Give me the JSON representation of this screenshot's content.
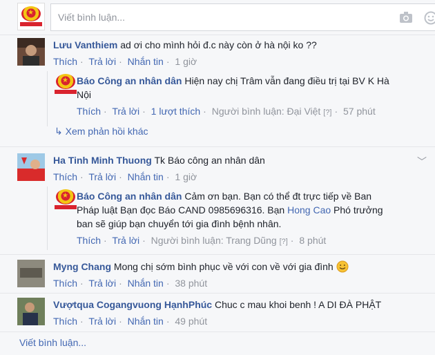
{
  "composer": {
    "placeholder": "Viết bình luận..."
  },
  "comments": [
    {
      "name": "Lưu Vanthiem",
      "text": "ad ơi cho mình hỏi đ.c này còn ở hà nội ko ??",
      "actions": {
        "like": "Thích",
        "reply": "Trả lời",
        "message": "Nhắn tin",
        "time": "1 giờ"
      },
      "reply": {
        "name": "Báo Công an nhân dân",
        "text_line1": "Hiện nay chị Trâm vẫn đang điều trị tại BV K Hà",
        "text_line2": "Nội",
        "actions": {
          "like": "Thích",
          "reply": "Trả lời",
          "likes": "1 lượt thích",
          "answered_by": "Người bình luận: Đại Việt",
          "help": "[?]",
          "time": "57 phút"
        }
      },
      "more_replies": "Xem phản hồi khác"
    },
    {
      "name": "Ha Tinh Minh Thuong",
      "text": "Tk Báo công an nhân dân",
      "actions": {
        "like": "Thích",
        "reply": "Trả lời",
        "message": "Nhắn tin",
        "time": "1 giờ"
      },
      "reply": {
        "name": "Báo Công an nhân dân",
        "text_line1a": "Cảm ơn bạn. Bạn có thể đt trực tiếp về Ban",
        "text_line2": "Pháp luật Bạn đọc Báo CAND 0985696316. Bạn",
        "mention": "Hong Cao",
        "text_line2b": "Phó trưởng",
        "text_line3": "ban sẽ giúp bạn chuyển tới gia đình bệnh nhân.",
        "actions": {
          "like": "Thích",
          "reply": "Trả lời",
          "answered_by": "Người bình luận: Trang Dũng",
          "help": "[?]",
          "time": "8 phút"
        }
      }
    },
    {
      "name": "Myng Chang",
      "text": "Mong chị sớm bình phục về với con về với gia đình",
      "actions": {
        "like": "Thích",
        "reply": "Trả lời",
        "message": "Nhắn tin",
        "time": "38 phút"
      }
    },
    {
      "name": "Vượtqua Cogangvuong HạnhPhúc",
      "text": "Chuc c mau khoi benh ! A DI ĐÀ PHẬT",
      "actions": {
        "like": "Thích",
        "reply": "Trả lời",
        "message": "Nhắn tin",
        "time": "49 phút"
      }
    }
  ],
  "footer": {
    "write_comment": "Viết bình luận..."
  },
  "colors": {
    "link": "#4267b2",
    "name": "#365899",
    "meta": "#90949c",
    "brand_red": "#d9232e",
    "brand_gold": "#f3c614"
  }
}
